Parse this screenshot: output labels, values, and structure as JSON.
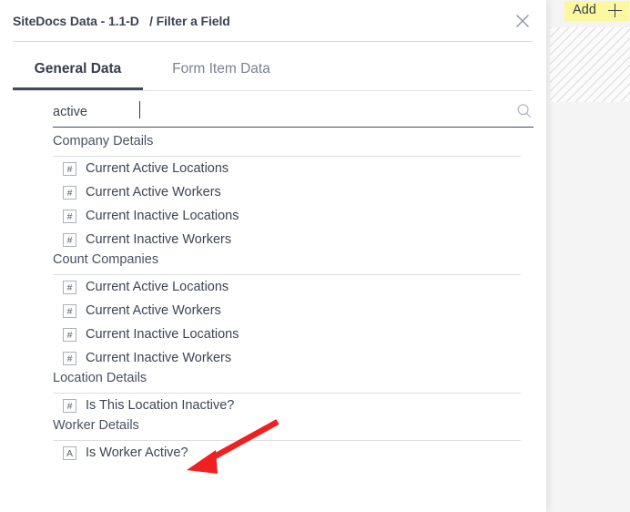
{
  "overlay": {
    "add_button": {
      "label": "Add",
      "icon": "plus-icon",
      "highlight_color": "#fcf8a0"
    }
  },
  "modal": {
    "title": "SiteDocs Data - 1.1-D   / Filter a Field",
    "close_icon": "close-icon",
    "tabs": [
      {
        "label": "General Data",
        "active": true
      },
      {
        "label": "Form Item Data",
        "active": false
      }
    ],
    "search": {
      "value": "active",
      "placeholder": "",
      "icon": "search-icon"
    },
    "groups": [
      {
        "header": "Company Details",
        "items": [
          {
            "type": "#",
            "label": "Current Active Locations"
          },
          {
            "type": "#",
            "label": "Current Active Workers"
          },
          {
            "type": "#",
            "label": "Current Inactive Locations"
          },
          {
            "type": "#",
            "label": "Current Inactive Workers"
          }
        ]
      },
      {
        "header": "Count Companies",
        "items": [
          {
            "type": "#",
            "label": "Current Active Locations"
          },
          {
            "type": "#",
            "label": "Current Active Workers"
          },
          {
            "type": "#",
            "label": "Current Inactive Locations"
          },
          {
            "type": "#",
            "label": "Current Inactive Workers"
          }
        ]
      },
      {
        "header": "Location Details",
        "items": [
          {
            "type": "#",
            "label": "Is This Location Inactive?"
          }
        ]
      },
      {
        "header": "Worker Details",
        "items": [
          {
            "type": "A",
            "label": "Is Worker Active?"
          }
        ]
      }
    ]
  },
  "annotation": {
    "arrow_color": "#ee2020",
    "points_to": "Is Worker Active?"
  }
}
